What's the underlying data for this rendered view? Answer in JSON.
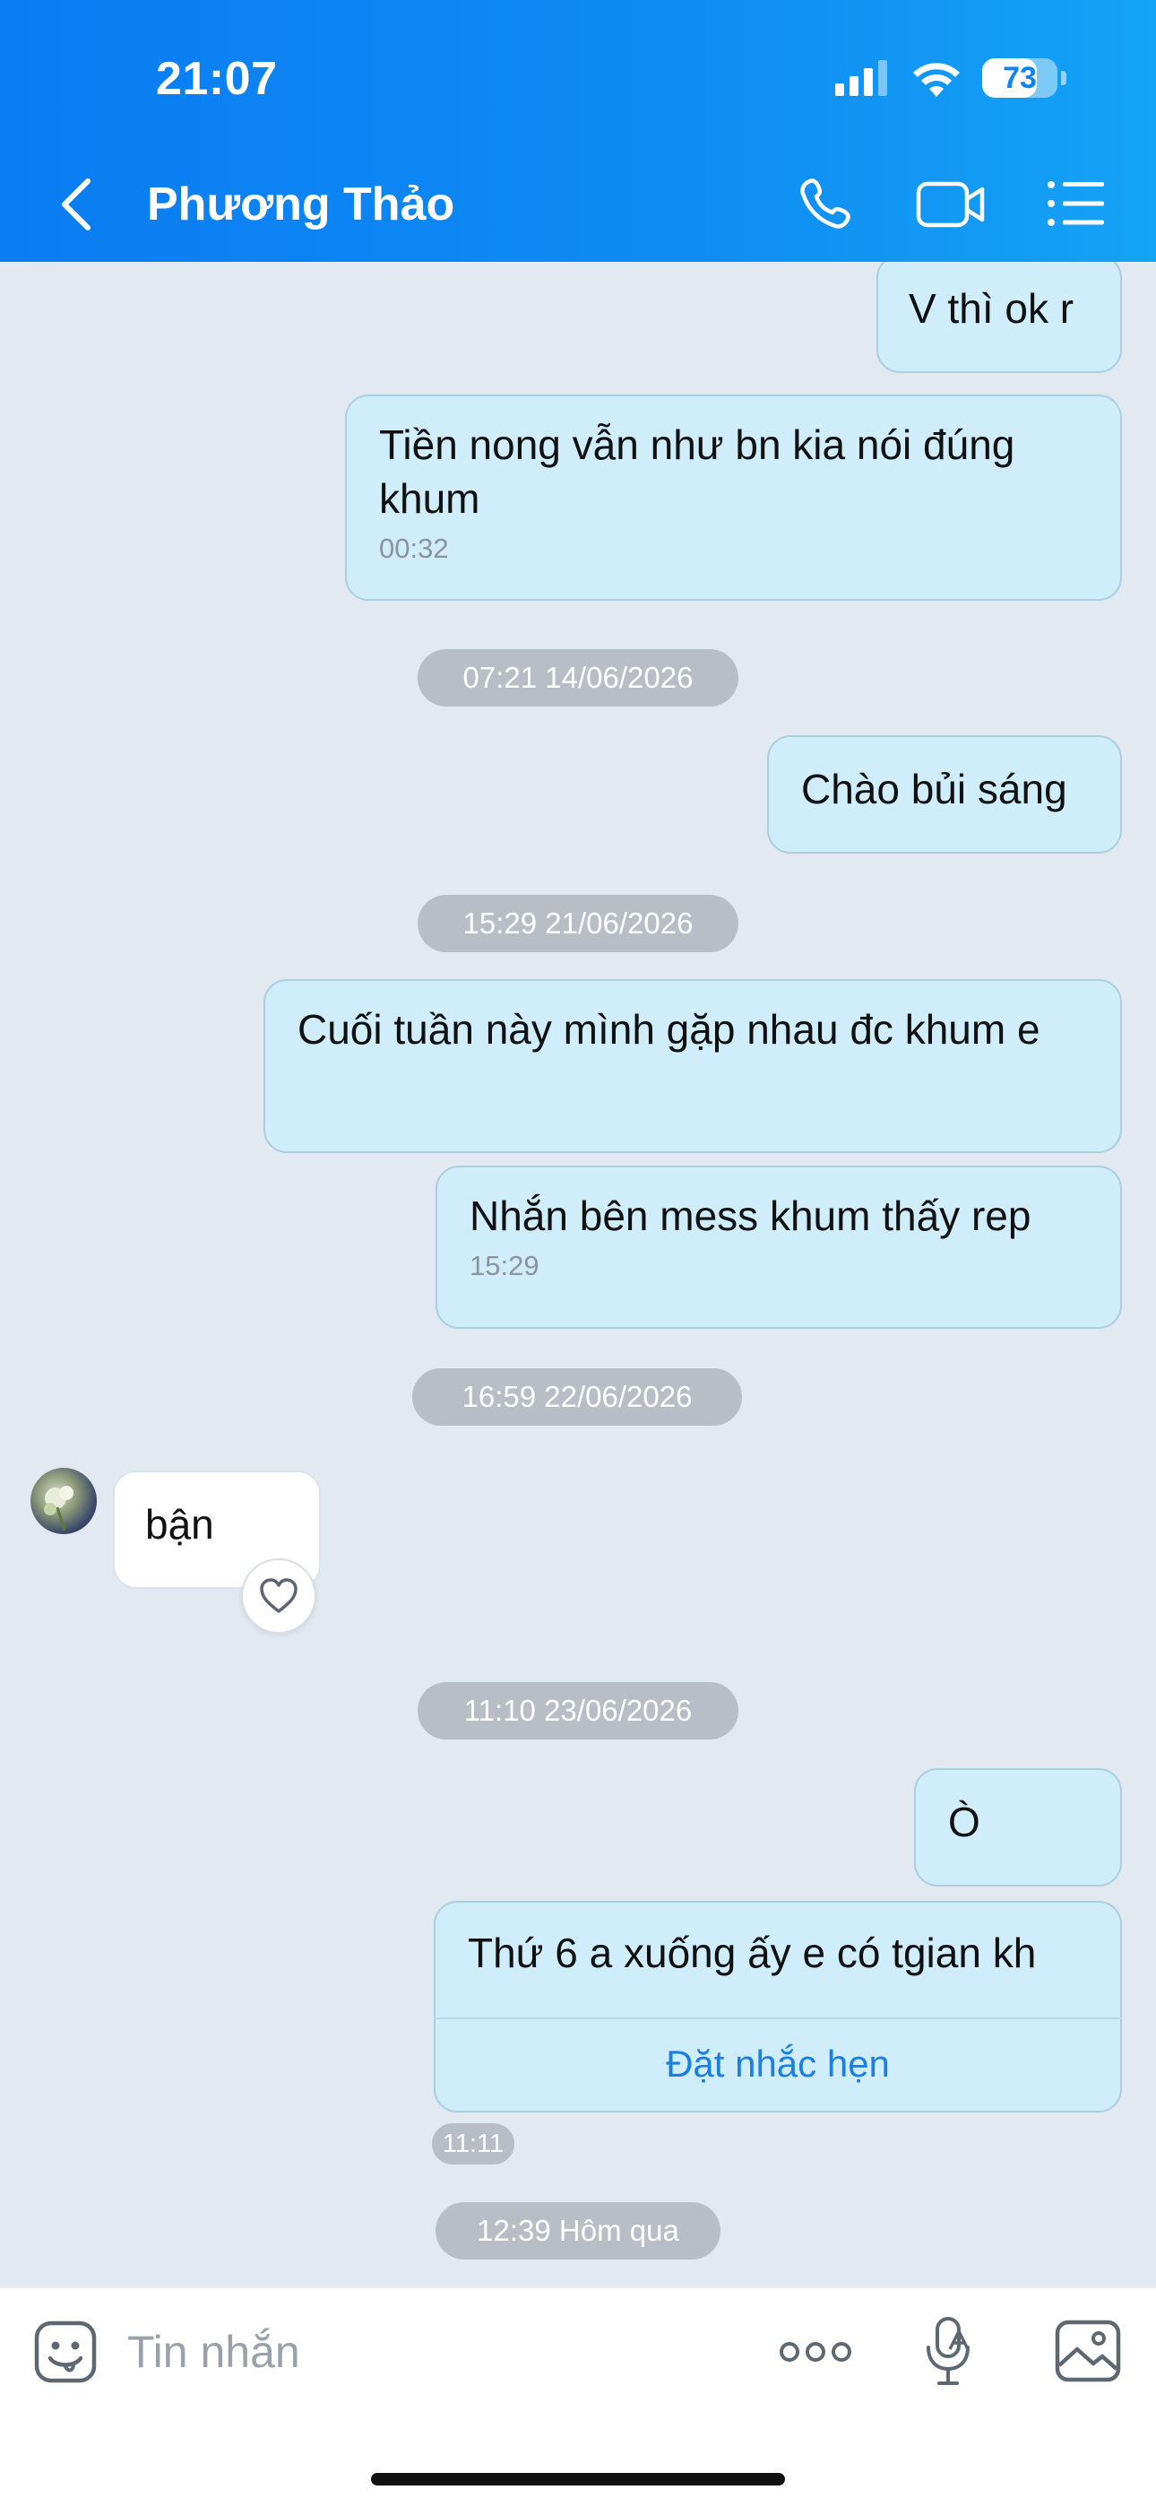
{
  "status_bar": {
    "time": "21:07",
    "battery_percent": "73",
    "battery_level": 0.73
  },
  "header": {
    "contact_name": "Phương Thảo",
    "back_icon": "chevron-left-icon",
    "call_icon": "phone-icon",
    "video_icon": "video-camera-icon",
    "menu_icon": "list-menu-icon"
  },
  "messages": [
    {
      "side": "out",
      "text": "V thì ok r"
    },
    {
      "side": "out",
      "text": "Tiền nong vẫn như bn kia nói đúng khum",
      "time": "00:32"
    },
    {
      "type": "date",
      "text": "07:21 14/06/2026"
    },
    {
      "side": "out",
      "text": "Chào bủi sáng"
    },
    {
      "type": "date",
      "text": "15:29 21/06/2026"
    },
    {
      "side": "out",
      "text": "Cuối tuần này mình gặp nhau đc khum e"
    },
    {
      "side": "out",
      "text": "Nhắn bên mess khum thấy rep",
      "time": "15:29"
    },
    {
      "type": "date",
      "text": "16:59 22/06/2026"
    },
    {
      "side": "in",
      "text": "bận"
    },
    {
      "type": "date",
      "text": "11:10 23/06/2026"
    },
    {
      "side": "out",
      "text": "Ò"
    },
    {
      "side": "out",
      "text": "Thứ 6 a xuống ấy e có tgian kh",
      "action": "Đặt nhắc hẹn",
      "time": "11:11"
    },
    {
      "type": "date",
      "text": "12:39 Hôm qua"
    }
  ],
  "input_bar": {
    "placeholder": "Tin nhắn",
    "emoji_icon": "sticker-face-icon",
    "more_icon": "more-dots-icon",
    "mic_icon": "voice-to-text-mic-icon",
    "image_icon": "image-gallery-icon"
  },
  "colors": {
    "header_gradient_start": "#0a7cf2",
    "header_gradient_end": "#14a3f5",
    "outgoing_bubble": "#cfedfb",
    "incoming_bubble": "#ffffff",
    "chat_background": "#e3e9f1",
    "date_pill": "#b9bec6",
    "link": "#1a7fe0"
  }
}
